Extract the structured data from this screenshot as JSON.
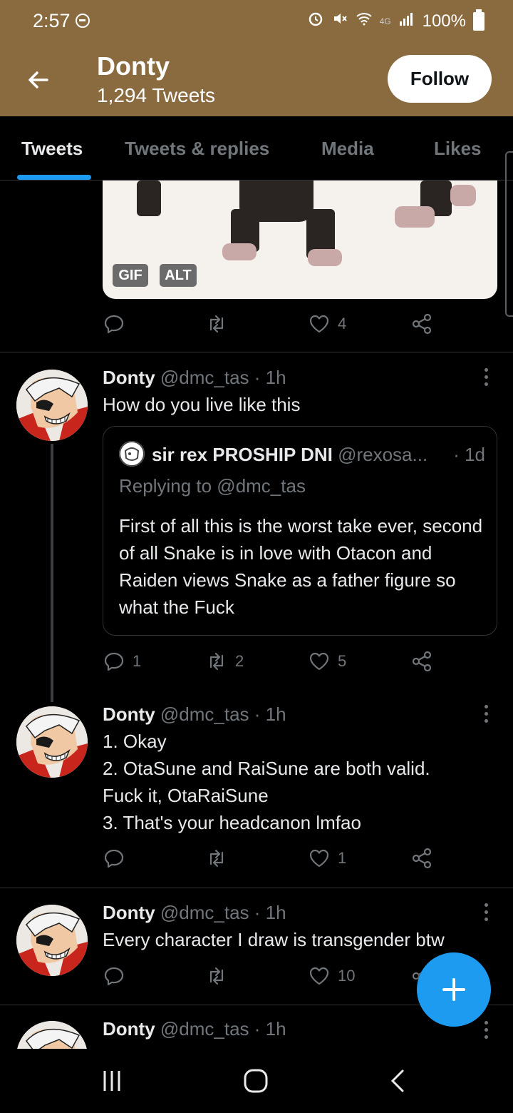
{
  "status_bar": {
    "time": "2:57",
    "battery": "100%",
    "network": "4G"
  },
  "header": {
    "name": "Donty",
    "tweet_count": "1,294 Tweets",
    "follow_label": "Follow"
  },
  "tabs": [
    {
      "label": "Tweets",
      "active": true
    },
    {
      "label": "Tweets & replies",
      "active": false
    },
    {
      "label": "Media",
      "active": false
    },
    {
      "label": "Likes",
      "active": false
    }
  ],
  "media_card": {
    "badges": [
      "GIF",
      "ALT"
    ]
  },
  "tweets": [
    {
      "replies": "",
      "retweets": "",
      "likes": "4"
    },
    {
      "name": "Donty",
      "handle": "@dmc_tas",
      "time": "· 1h",
      "text": "How do you live like this",
      "quote": {
        "name": "sir rex PROSHIP DNI",
        "handle": "@rexosa...",
        "time": "· 1d",
        "replying_to": "Replying to @dmc_tas",
        "text": "First of all this is the worst take ever, second of all Snake is in love with Otacon and Raiden views Snake as a father figure so what the Fuck"
      },
      "replies": "1",
      "retweets": "2",
      "likes": "5"
    },
    {
      "name": "Donty",
      "handle": "@dmc_tas",
      "time": "· 1h",
      "text": "1. Okay\n2. OtaSune and RaiSune are both valid.\nFuck it, OtaRaiSune\n3. That's your headcanon lmfao",
      "replies": "",
      "retweets": "",
      "likes": "1"
    },
    {
      "name": "Donty",
      "handle": "@dmc_tas",
      "time": "· 1h",
      "text": "Every character I draw is transgender btw",
      "replies": "",
      "retweets": "",
      "likes": "10"
    },
    {
      "name": "Donty",
      "handle": "@dmc_tas",
      "time": "· 1h"
    }
  ],
  "colors": {
    "header_bg": "#8a6a3f",
    "accent": "#1d9bf0",
    "muted": "#71767b"
  }
}
